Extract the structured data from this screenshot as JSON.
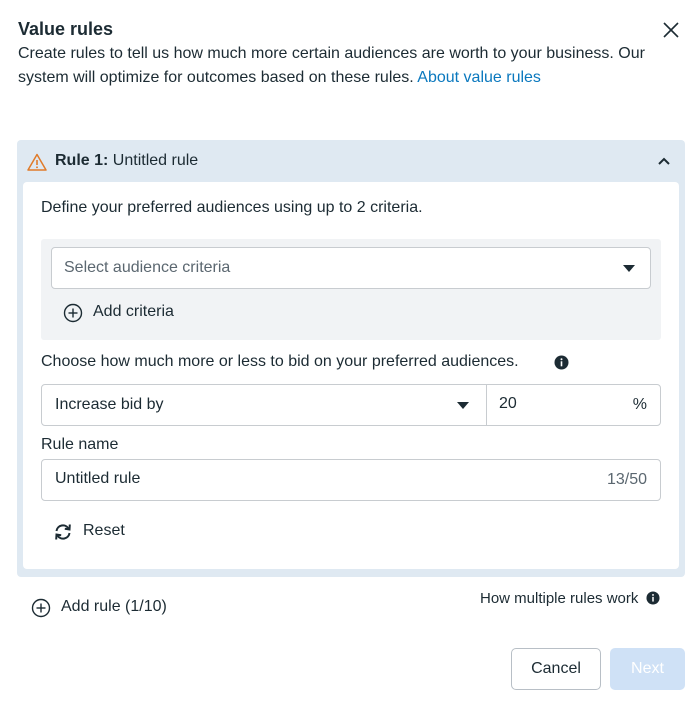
{
  "dialog": {
    "title": "Value rules",
    "description": "Create rules to tell us how much more certain audiences are worth to your business. Our system will optimize for outcomes based on these rules.",
    "about_link": "About value rules",
    "close_icon": "close-icon"
  },
  "rule": {
    "number_label": "Rule 1:",
    "name": "Untitled rule",
    "warning_icon": "warning-icon",
    "collapse_icon": "chevron-up-icon",
    "criteria_instruction": "Define your preferred audiences using up to 2 criteria.",
    "criteria_placeholder": "Select audience criteria",
    "add_criteria_label": "Add criteria",
    "bid_instruction": "Choose how much more or less to bid on your preferred audiences.",
    "bid_direction": "Increase bid by",
    "bid_value": "20",
    "bid_unit": "%",
    "rule_name_label": "Rule name",
    "rule_name_value": "Untitled rule",
    "rule_name_count": "13/50",
    "reset_label": "Reset"
  },
  "footer": {
    "add_rule_label": "Add rule (1/10)",
    "how_rules_work": "How multiple rules work",
    "cancel_label": "Cancel",
    "next_label": "Next"
  },
  "colors": {
    "accent_link": "#0a78be",
    "rule_card_bg": "#dfe9f2",
    "next_disabled_bg": "#cfe1f6",
    "warning": "#e07b2a"
  }
}
